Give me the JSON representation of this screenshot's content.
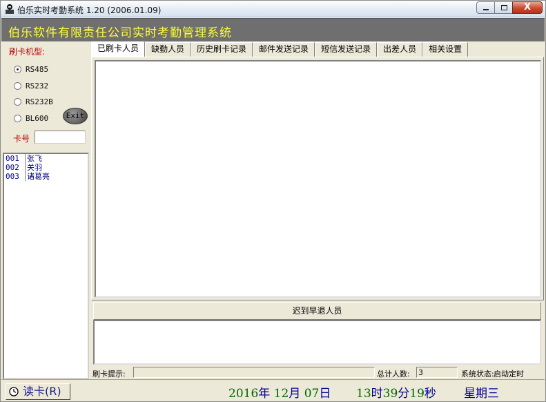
{
  "window": {
    "title": "伯乐实时考勤系统 1.20 (2006.01.09)",
    "close_glyph": "X"
  },
  "banner": {
    "text": "伯乐软件有限责任公司实时考勤管理系统"
  },
  "left": {
    "card_type_label": "刷卡机型:",
    "radios": [
      {
        "label": "RS485",
        "checked": true
      },
      {
        "label": "RS232",
        "checked": false
      },
      {
        "label": "RS232B",
        "checked": false
      },
      {
        "label": "BL600",
        "checked": false
      }
    ],
    "exit_label": "Exit",
    "card_no_label": "卡号",
    "card_no_value": ""
  },
  "employees": [
    {
      "id": "001",
      "name": "张飞"
    },
    {
      "id": "002",
      "name": "关羽"
    },
    {
      "id": "003",
      "name": "诸葛亮"
    }
  ],
  "tabs": [
    "已刷卡人员",
    "缺勤人员",
    "历史刷卡记录",
    "邮件发送记录",
    "短信发送记录",
    "出差人员",
    "相关设置"
  ],
  "active_tab": 0,
  "late_section": {
    "label": "迟到早退人员"
  },
  "status": {
    "hint_label": "刷卡提示:",
    "hint_value": "",
    "total_label": "总计人数:",
    "total_value": "3",
    "system_label": "系统状态:",
    "system_value": "启动定时"
  },
  "bottom": {
    "read_card_label": "读卡(R)",
    "date": {
      "year": "2016",
      "year_unit": "年",
      "month": "12",
      "month_unit": "月",
      "day": "07",
      "day_unit": "日"
    },
    "time": {
      "hour": "13",
      "hour_unit": "时",
      "minute": "39",
      "minute_unit": "分",
      "second": "19",
      "second_unit": "秒"
    },
    "weekday": "星期三"
  },
  "colors": {
    "banner_bg": "#6f6f6f",
    "banner_text": "#ffff33",
    "label_red": "#b00000",
    "list_text": "#000080",
    "date_green": "#006600",
    "date_blue": "#000099"
  },
  "icons": [
    "app-icon",
    "minimize-icon",
    "maximize-icon",
    "close-icon",
    "clock-icon"
  ]
}
